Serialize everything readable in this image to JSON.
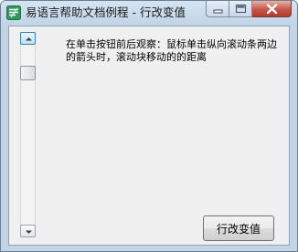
{
  "window": {
    "title": "易语言帮助文档例程 - 行改变值",
    "icon": "easy-language-app-icon",
    "accent_color": "#c3d4e6",
    "close_color": "#c4574a"
  },
  "controls": {
    "minimize_icon": "minimize-icon",
    "maximize_icon": "maximize-icon",
    "close_icon": "close-icon"
  },
  "scrollbar": {
    "up_icon": "arrow-up-icon",
    "down_icon": "arrow-down-icon",
    "position": 0.2
  },
  "content": {
    "description": "在单击按钮前后观察：鼠标单击纵向滚动条两边的箭头时，滚动块移动的的距离",
    "button_label": "行改变值"
  }
}
